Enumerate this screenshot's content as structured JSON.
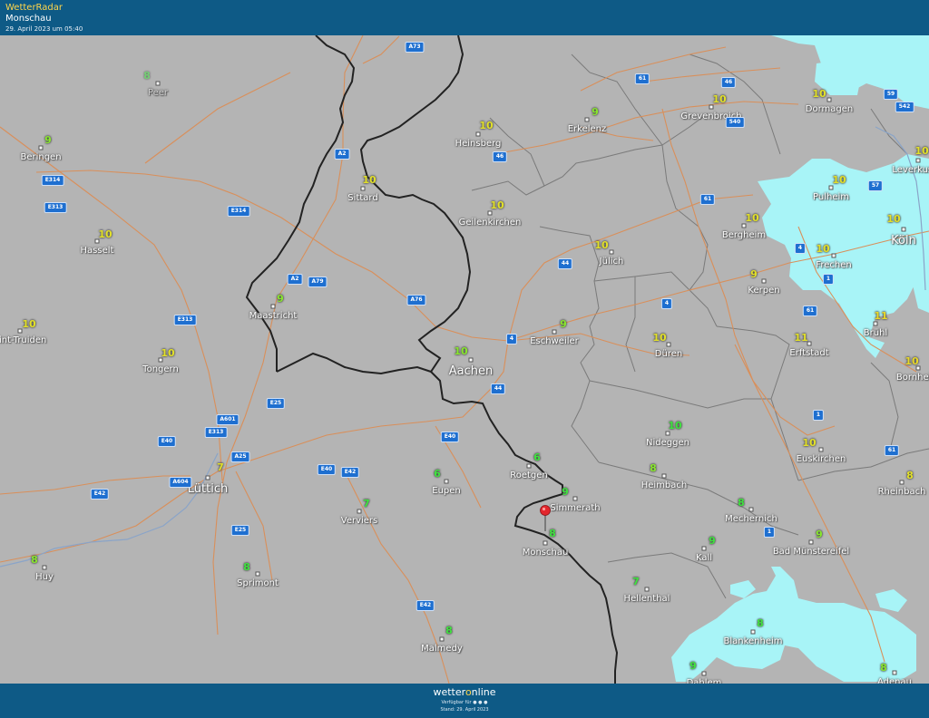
{
  "header": {
    "app_title": "WetterRadar",
    "location": "Monschau",
    "datetime": "29. April 2023 um 05:40"
  },
  "footer": {
    "brand_prefix": "wetter",
    "brand_o": "o",
    "brand_suffix": "nline",
    "availability": "Verfügbar für",
    "platform_icons": [
      "android-icon",
      "apple-icon",
      "windows-icon"
    ],
    "stand": "Stand: 29. April 2023"
  },
  "colors": {
    "header": "#0e5a86",
    "map_ground": "#b4b4b4",
    "precip": "#a8f4f7",
    "border": "#222222",
    "roads": "#d98f5a",
    "highway_shield": "#1e6fd0",
    "temp_8": "#3fe23f",
    "temp_9": "#88e62e",
    "temp_10": "#e2e02a"
  },
  "map": {
    "selected_location": "Monschau",
    "cities": [
      "Peer",
      "Beringen",
      "Hasselt",
      "Sint-Truiden",
      "Tongern",
      "Maastricht",
      "Sittard",
      "Heinsberg",
      "Erkelenz",
      "Grevenbroich",
      "Dormagen",
      "Leverkusen",
      "Geilenkirchen",
      "Pulheim",
      "Köln",
      "Bergheim",
      "Frechen",
      "Jülich",
      "Kerpen",
      "Aachen",
      "Eschweiler",
      "Düren",
      "Erftstadt",
      "Brühl",
      "Bornheim",
      "Lüttich",
      "Eupen",
      "Roetgen",
      "Simmerath",
      "Heimbach",
      "Nideggen",
      "Euskirchen",
      "Rheinbach",
      "Verviers",
      "Monschau",
      "Mechernich",
      "Kall",
      "Bad Münstereifel",
      "Huy",
      "Sprimont",
      "Hellenthal",
      "Blankenheim",
      "Malmedy",
      "Dahlem",
      "Adenau"
    ],
    "temperatures": [
      "8",
      "9",
      "10",
      "10",
      "10",
      "9",
      "10",
      "10",
      "9",
      "10",
      "10",
      "10",
      "10",
      "10",
      "10",
      "10",
      "10",
      "10",
      "9",
      "10",
      "9",
      "10",
      "11",
      "11",
      "10",
      "7",
      "6",
      "6",
      "9",
      "8",
      "10",
      "10",
      "8",
      "7",
      "8",
      "8",
      "9",
      "9",
      "8",
      "8",
      "7",
      "8",
      "8",
      "9",
      "8"
    ],
    "highways": [
      "A73",
      "61",
      "46",
      "540",
      "59",
      "542",
      "57",
      "A2",
      "46",
      "E314",
      "E313",
      "E314",
      "61",
      "4",
      "1",
      "A2",
      "A79",
      "44",
      "A76",
      "E313",
      "4",
      "4",
      "61",
      "44",
      "1",
      "E25",
      "A601",
      "E313",
      "E40",
      "A25",
      "E40",
      "E40",
      "E42",
      "A604",
      "E42",
      "61",
      "E25",
      "1",
      "E42"
    ]
  }
}
